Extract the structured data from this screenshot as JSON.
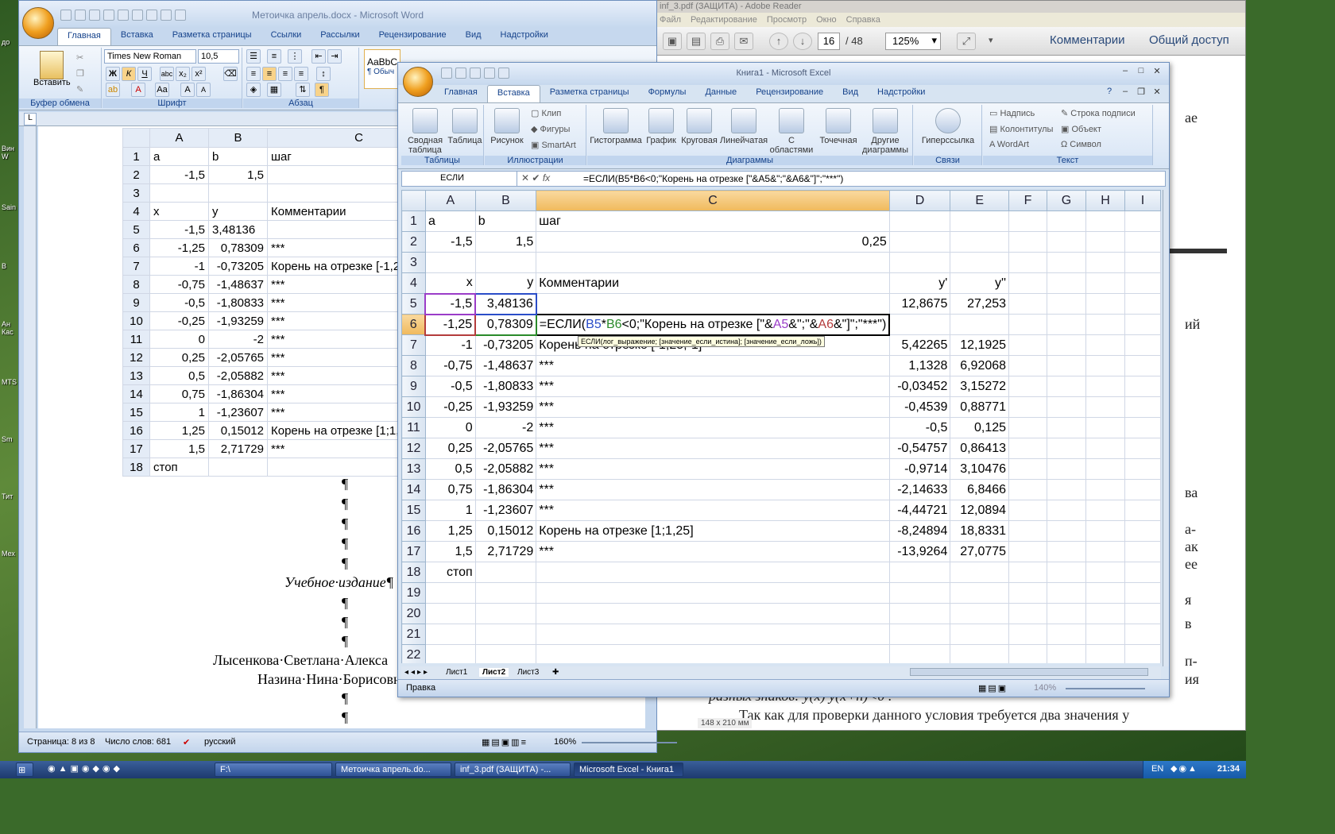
{
  "desktop_icons": [
    "до",
    "Вин W",
    "Sain",
    "В",
    "Ан Кас",
    "MTS",
    "Sm",
    "Тит",
    "Мех"
  ],
  "word": {
    "title": "Метоичка апрель.docx - Microsoft Word",
    "tabs": [
      "Главная",
      "Вставка",
      "Разметка страницы",
      "Ссылки",
      "Рассылки",
      "Рецензирование",
      "Вид",
      "Надстройки"
    ],
    "font_name": "Times New Roman",
    "font_size": "10,5",
    "paste_label": "Вставить",
    "group_clipboard": "Буфер обмена",
    "group_font": "Шрифт",
    "group_paragraph": "Абзац",
    "style_preview": "AaBbC",
    "style_name": "¶ Обыч",
    "col_headers": [
      "A",
      "B",
      "C"
    ],
    "rows": [
      [
        "1",
        "a",
        "b",
        "шаг"
      ],
      [
        "2",
        "-1,5",
        "1,5",
        ""
      ],
      [
        "3",
        "",
        "",
        ""
      ],
      [
        "4",
        "x",
        "y",
        "Комментарии"
      ],
      [
        "5",
        "-1,5",
        "3,48136",
        ""
      ],
      [
        "6",
        "-1,25",
        "0,78309",
        "***"
      ],
      [
        "7",
        "-1",
        "-0,73205",
        "Корень на отрезке [-1,25;"
      ],
      [
        "8",
        "-0,75",
        "-1,48637",
        "***"
      ],
      [
        "9",
        "-0,5",
        "-1,80833",
        "***"
      ],
      [
        "10",
        "-0,25",
        "-1,93259",
        "***"
      ],
      [
        "11",
        "0",
        "-2",
        "***"
      ],
      [
        "12",
        "0,25",
        "-2,05765",
        "***"
      ],
      [
        "13",
        "0,5",
        "-2,05882",
        "***"
      ],
      [
        "14",
        "0,75",
        "-1,86304",
        "***"
      ],
      [
        "15",
        "1",
        "-1,23607",
        "***"
      ],
      [
        "16",
        "1,25",
        "0,15012",
        "Корень на отрезке [1;1,25"
      ],
      [
        "17",
        "1,5",
        "2,71729",
        "***"
      ],
      [
        "18",
        "стоп",
        "",
        ""
      ]
    ],
    "pilcrow": "¶",
    "edition": "Учебное·издание¶",
    "author1": "Лысенкова·Светлана·Алекса",
    "author2": "Назина·Нина·Борисовн",
    "status_page": "Страница: 8 из 8",
    "status_words": "Число слов: 681",
    "status_lang": "русский",
    "zoom": "160%"
  },
  "adobe": {
    "title": "inf_3.pdf (ЗАЩИТА) - Adobe Reader",
    "menu": [
      "Файл",
      "Редактирование",
      "Просмотр",
      "Окно",
      "Справка"
    ],
    "page_current": "16",
    "page_total": "/ 48",
    "zoom": "125%",
    "comments": "Комментарии",
    "share": "Общий доступ",
    "page_size": "148 x 210 мм",
    "text_lines": [
      "ае",
      "ий",
      "ва",
      "а-",
      "ак",
      "ее",
      "я",
      "в",
      "п-",
      "ия",
      "разных знаков: y(x)·y(x+h)<0 .",
      "Так как для проверки данного условия требуется два значения y"
    ]
  },
  "excel": {
    "title": "Книга1 - Microsoft Excel",
    "tabs": [
      "Главная",
      "Вставка",
      "Разметка страницы",
      "Формулы",
      "Данные",
      "Рецензирование",
      "Вид",
      "Надстройки"
    ],
    "ribbon": {
      "pivot": "Сводная таблица",
      "table": "Таблица",
      "picture": "Рисунок",
      "clip": "Клип",
      "shapes": "Фигуры",
      "smartart": "SmartArt",
      "histogram": "Гистограмма",
      "chart": "График",
      "pie": "Круговая",
      "linear": "Линейчатая",
      "area": "С областями",
      "scatter": "Точечная",
      "other": "Другие диаграммы",
      "hyperlink": "Гиперссылка",
      "textbox": "Надпись",
      "headers": "Колонтитулы",
      "wordart": "WordArt",
      "signature": "Строка подписи",
      "object": "Объект",
      "symbol": "Символ",
      "g_tables": "Таблицы",
      "g_illustr": "Иллюстрации",
      "g_charts": "Диаграммы",
      "g_links": "Связи",
      "g_text": "Текст"
    },
    "namebox": "ЕСЛИ",
    "formula": "=ЕСЛИ(B5*B6<0;\"Корень на отрезке [\"&A5&\";\"&A6&\"]\";\"***\")",
    "col_headers": [
      "A",
      "B",
      "C",
      "D",
      "E",
      "F",
      "G",
      "H",
      "I"
    ],
    "rows": [
      [
        "1",
        "a",
        "b",
        "шаг",
        "",
        ""
      ],
      [
        "2",
        "-1,5",
        "1,5",
        "0,25",
        "",
        ""
      ],
      [
        "3",
        "",
        "",
        "",
        "",
        ""
      ],
      [
        "4",
        "x",
        "y",
        "Комментарии",
        "y'",
        "y''"
      ],
      [
        "5",
        "-1,5",
        "3,48136",
        "",
        "12,8675",
        "27,253"
      ],
      [
        "6",
        "-1,25",
        "0,78309",
        "",
        "",
        ""
      ],
      [
        "7",
        "-1",
        "-0,73205",
        "Корень на отрезке [-1,25;-1]",
        "5,42265",
        "12,1925"
      ],
      [
        "8",
        "-0,75",
        "-1,48637",
        "***",
        "1,1328",
        "6,92068"
      ],
      [
        "9",
        "-0,5",
        "-1,80833",
        "***",
        "-0,03452",
        "3,15272"
      ],
      [
        "10",
        "-0,25",
        "-1,93259",
        "***",
        "-0,4539",
        "0,88771"
      ],
      [
        "11",
        "0",
        "-2",
        "***",
        "-0,5",
        "0,125"
      ],
      [
        "12",
        "0,25",
        "-2,05765",
        "***",
        "-0,54757",
        "0,86413"
      ],
      [
        "13",
        "0,5",
        "-2,05882",
        "***",
        "-0,9714",
        "3,10476"
      ],
      [
        "14",
        "0,75",
        "-1,86304",
        "***",
        "-2,14633",
        "6,8466"
      ],
      [
        "15",
        "1",
        "-1,23607",
        "***",
        "-4,44721",
        "12,0894"
      ],
      [
        "16",
        "1,25",
        "0,15012",
        "Корень на отрезке [1;1,25]",
        "-8,24894",
        "18,8331"
      ],
      [
        "17",
        "1,5",
        "2,71729",
        "***",
        "-13,9264",
        "27,0775"
      ],
      [
        "18",
        "стоп",
        "",
        "",
        "",
        ""
      ],
      [
        "19",
        "",
        "",
        "",
        "",
        ""
      ],
      [
        "20",
        "",
        "",
        "",
        "",
        ""
      ],
      [
        "21",
        "",
        "",
        "",
        "",
        ""
      ],
      [
        "22",
        "",
        "",
        "",
        "",
        ""
      ]
    ],
    "edit_formula": {
      "p1": "=ЕСЛИ(",
      "ref1": "B5",
      "p2": "*",
      "ref2": "B6",
      "p3": "<0;\"Корень на отрезке [\"&",
      "ref3": "A5",
      "p4": "&\";\"&",
      "ref4": "A6",
      "p5": "&\"]\";\"***\")"
    },
    "tooltip": "ЕСЛИ(лог_выражение; [значение_если_истина]; [значение_если_ложь])",
    "sheets": [
      "Лист1",
      "Лист2",
      "Лист3"
    ],
    "status": "Правка",
    "zoom": "140%"
  },
  "taskbar": {
    "drive": "F:\\",
    "tasks": [
      "Метоичка апрель.do...",
      "inf_3.pdf (ЗАЩИТА) -...",
      "Microsoft Excel - Книга1"
    ],
    "lang": "EN",
    "clock": "21:34"
  }
}
